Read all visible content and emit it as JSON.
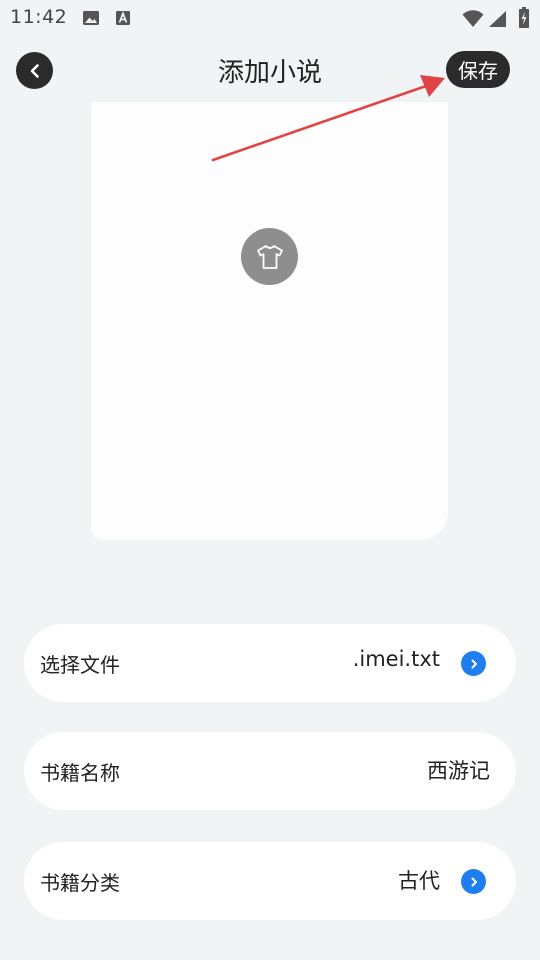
{
  "status": {
    "time": "11:42"
  },
  "header": {
    "title": "添加小说",
    "save_label": "保存"
  },
  "colors": {
    "accent": "#1e7ef0",
    "dark_button": "#2b2b2b",
    "arrow": "#e04444",
    "background": "#f1f4f4"
  },
  "cover": {
    "icon": "tshirt-icon"
  },
  "form": {
    "file_label": "选择文件",
    "file_value": ".imei.txt",
    "name_label": "书籍名称",
    "name_value": "西游记",
    "category_label": "书籍分类",
    "category_value": "古代"
  }
}
